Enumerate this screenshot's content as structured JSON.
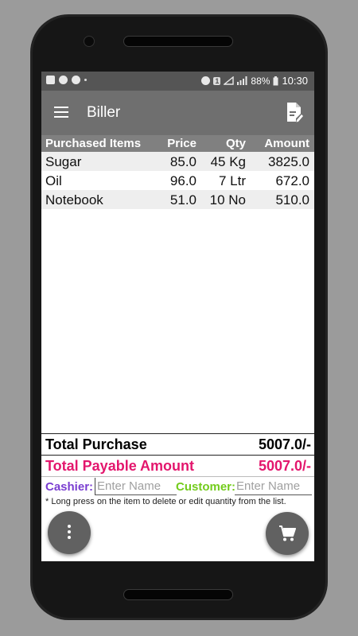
{
  "status_bar": {
    "battery": "88%",
    "time": "10:30",
    "sim": "1"
  },
  "app_bar": {
    "title": "Biller",
    "menu_icon": "hamburger-menu-icon",
    "action_icon": "document-edit-icon"
  },
  "table": {
    "headers": {
      "item": "Purchased Items",
      "price": "Price",
      "qty": "Qty",
      "amount": "Amount"
    },
    "rows": [
      {
        "item": "Sugar",
        "price": "85.0",
        "qty": "45 Kg",
        "amount": "3825.0"
      },
      {
        "item": "Oil",
        "price": "96.0",
        "qty": "7 Ltr",
        "amount": "672.0"
      },
      {
        "item": "Notebook",
        "price": "51.0",
        "qty": "10 No",
        "amount": "510.0"
      }
    ]
  },
  "totals": {
    "purchase_label": "Total Purchase",
    "purchase_value": "5007.0/-",
    "payable_label": "Total Payable Amount",
    "payable_value": "5007.0/-"
  },
  "names": {
    "cashier_label": "Cashier:",
    "cashier_placeholder": "Enter Name",
    "customer_label": "Customer:",
    "customer_placeholder": "Enter Name"
  },
  "note": "* Long press on the item to delete or edit quantity from the list.",
  "fabs": {
    "left_icon": "more-vertical-icon",
    "right_icon": "cart-icon"
  },
  "colors": {
    "app_bar": "#6f6f6f",
    "status_bar": "#555555",
    "table_header": "#808080",
    "row_alt": "#eeeeee",
    "payable": "#e3166d",
    "cashier": "#7a3ed1",
    "customer": "#73cc1c",
    "fab": "#616161"
  }
}
